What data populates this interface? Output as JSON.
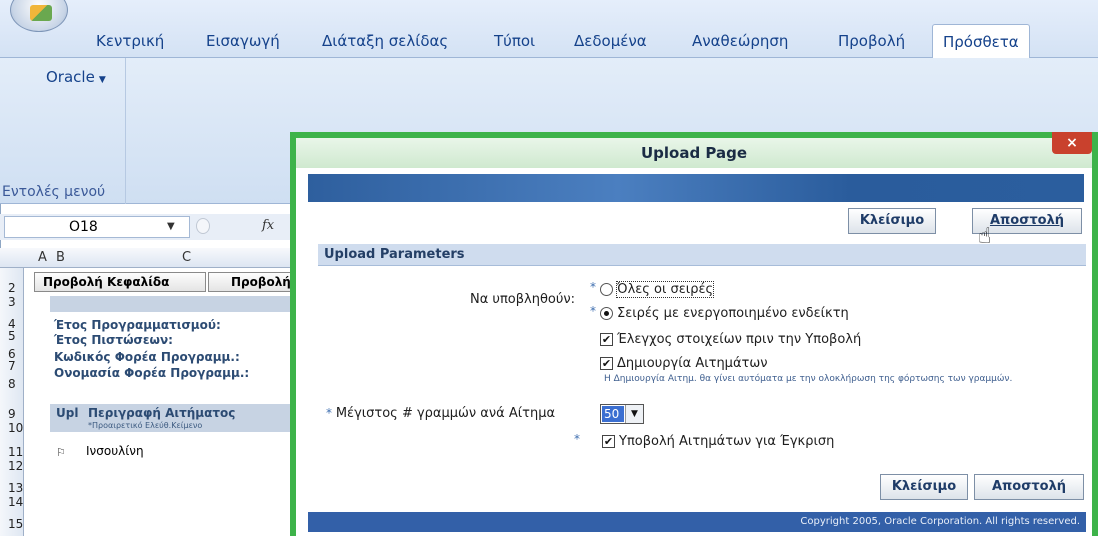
{
  "ribbon": {
    "tabs": [
      "Κεντρική",
      "Εισαγωγή",
      "Διάταξη σελίδας",
      "Τύποι",
      "Δεδομένα",
      "Αναθεώρηση",
      "Προβολή",
      "Πρόσθετα"
    ],
    "oracle_menu": "Oracle",
    "group_label": "Εντολές μενού"
  },
  "formula_bar": {
    "name_box": "O18",
    "fx": "fx"
  },
  "sheet": {
    "columns": [
      "A",
      "B",
      "C"
    ],
    "rows": [
      "2",
      "3",
      "4",
      "5",
      "6",
      "7",
      "8",
      "9",
      "10",
      "11",
      "12",
      "13",
      "14",
      "15"
    ],
    "button_header": "Προβολή Κεφαλίδα",
    "button_view": "Προβολή",
    "labels": [
      "Έτος Προγραμματισμού:",
      "Έτος Πιστώσεων:",
      "Κωδικός Φορέα Προγραμμ.:",
      "Ονομασία Φορέα Προγραμμ.:"
    ],
    "upl_header": "Upl",
    "desc_header": "Περιγραφή Αιτήματος",
    "desc_sub": "*Προαιρετικό Ελεύθ.Κείμενο",
    "row_flag": "⚐",
    "row_value": "Ινσουλίνη"
  },
  "dialog": {
    "title": "Upload Page",
    "close": "×",
    "close_button": "Κλείσιμο",
    "submit_button": "Αποστολή",
    "section": "Upload Parameters",
    "submit_label": "Να υποβληθούν:",
    "radio_all": "Όλες οι σειρές",
    "radio_flagged": "Σειρές με ενεργοποιημένο ενδείκτη",
    "check_validate": "Έλεγχος στοιχείων πριν την Υποβολή",
    "check_create": "Δημιουργία Αιτημάτων",
    "hint": "Η Δημιουργία Αιτημ. θα γίνει αυτόματα με την ολοκλήρωση της φόρτωσης των γραμμών.",
    "max_rows_label": "Μέγιστος # γραμμών ανά Αίτημα",
    "max_rows_value": "50",
    "check_approve": "Υποβολή Αιτημάτων για Έγκριση",
    "copyright": "Copyright 2005, Oracle Corporation. All rights reserved."
  },
  "colors": {
    "dialog_frame": "#3db34a",
    "oracle_blue": "#3360a8",
    "close_red": "#c9412d"
  }
}
